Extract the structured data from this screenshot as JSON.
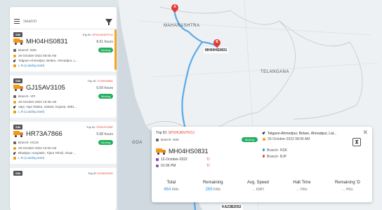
{
  "search": {
    "placeholder": "Search"
  },
  "trips": [
    {
      "sim": "SIM",
      "trip_prefix": "Trip ID:",
      "trip_id": "SPXHUKN7FCU",
      "vehicle": "MH04HS0831",
      "hours": "8.61 hours",
      "branch": "Branch- NSK",
      "status": "Moving",
      "date": "26-October-2022 08:06 AM",
      "location": "Telgaon-Ahmedpur, Belare, Ahmadpur, L...",
      "lr": "L.R.(Loading start)"
    },
    {
      "sim": "SIM",
      "trip_prefix": "Trip ID:",
      "trip_id": "V7HKHMNK",
      "vehicle": "GJ15AV3105",
      "hours": "6.09 hours",
      "branch": "Branch- VPI",
      "status": "Moving",
      "date": "26-October-2022 10:36 AM",
      "location": "Vapi, Vapi Taluka, Valsad, Gujarat, 3961...",
      "lr": "L.R.(Loading start)"
    },
    {
      "sim": "SIM",
      "trip_prefix": "Trip ID:",
      "trip_id": "FEDKSYR8P",
      "vehicle": "HR73A7866",
      "hours": "5.68 hours",
      "branch": "Branch- HOJS",
      "status": "Moving",
      "date": "26-October-2022 10:00 AM",
      "location": "Bhadpar, Hospitals, Tijara Tehsil, Alwar ...",
      "lr": "L.R.(Loading start)"
    },
    {
      "sim": "SIM",
      "trip_prefix": "Trip ID:",
      "trip_id": "NO5KEDKK"
    }
  ],
  "map": {
    "label_maharashtra": "MAHARASHTRA",
    "label_telangana": "TELANGANA",
    "label_goa": "GOA",
    "marker_a": "A",
    "marker_b": "B",
    "tag_b": "MH04HS0831",
    "tag_bottom": "KA23B2052"
  },
  "popup": {
    "trip_prefix": "Trip ID:",
    "trip_id": "SPXHUKN7FCU",
    "branch": "Branch- NSK",
    "status": "Moving",
    "location": "Telgaon-Ahmedpur, Belare, Ahmadpur, Lat...",
    "date": "26-October-2022 08:06 AM",
    "vehicle": "MH04HS0831",
    "branch_from": "Branch- NSK",
    "branch_to": "Branch- BJP",
    "start_date": "12-October-2022",
    "start_date_x": "'D",
    "start_time": "01:06 PM",
    "start_time_x": "'D",
    "stats": [
      {
        "label": "Total",
        "value": "464",
        "unit": " KMs"
      },
      {
        "label": "Remaining",
        "value": "269",
        "unit": " KMs"
      },
      {
        "label": "Avg. Speed",
        "value": "",
        "unit": "... KMH"
      },
      {
        "label": "Halt Time",
        "value": "",
        "unit": "... HRs"
      },
      {
        "label": "Remaining 'D",
        "value": "",
        "unit": "... HRs"
      }
    ]
  },
  "colors": {
    "accent": "#f5a623",
    "moving": "#27ae60",
    "route": "#5aa9e6",
    "marker": "#e53935",
    "trip_id": "#e53935"
  }
}
